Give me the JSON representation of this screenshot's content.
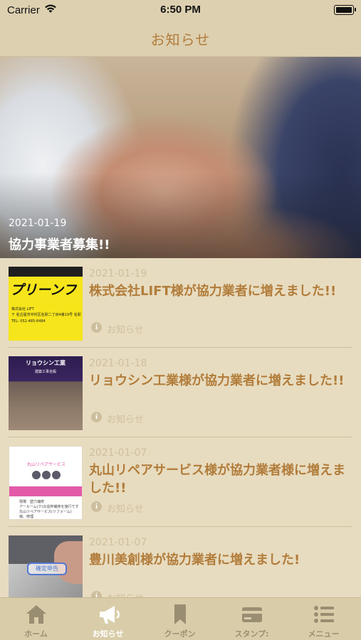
{
  "status_bar": {
    "carrier": "Carrier",
    "time": "6:50 PM"
  },
  "header": {
    "title": "お知らせ"
  },
  "hero": {
    "date": "2021-01-19",
    "title": "協力事業者募集!!"
  },
  "news": [
    {
      "date": "2021-01-19",
      "title": "株式会社LIFT様が協力業者に増えました!!",
      "category": "お知らせ",
      "thumb_text": {
        "banner": "プリーンフ",
        "line1": "株式会社 LIFT",
        "line2": "〒 名古屋市中村区名駅二丁目4番19号 名駅",
        "line3": "TEL: 052-485-6484"
      }
    },
    {
      "date": "2021-01-18",
      "title": "リョウシン工業様が協力業者に増えました!!",
      "category": "お知らせ",
      "thumb_text": {
        "name": "リョウシン工業",
        "sub": "建築工事全般"
      }
    },
    {
      "date": "2021-01-07",
      "title": "丸山リペアサービス様が協力業者様に増えました!!",
      "category": "お知らせ",
      "thumb_text": {
        "name": "丸山リペアサービス",
        "l1": "現場　壁穴補修",
        "l2": "アールーム(ク)の窓枠補修を施行です",
        "l3": "丸山リペアサービス(リフォーム)",
        "l4": "様。修理"
      }
    },
    {
      "date": "2021-01-07",
      "title": "豊川美創様が協力業者に増えました!",
      "category": "お知らせ",
      "thumb_text": {
        "stamp": "確定申告"
      }
    }
  ],
  "tabs": [
    {
      "label": "ホーム",
      "icon": "home-icon"
    },
    {
      "label": "お知らせ",
      "icon": "megaphone-icon",
      "active": true
    },
    {
      "label": "クーポン",
      "icon": "bookmark-icon"
    },
    {
      "label": "スタンプ:",
      "icon": "card-icon"
    },
    {
      "label": "メニュー",
      "icon": "menu-list-icon"
    }
  ]
}
